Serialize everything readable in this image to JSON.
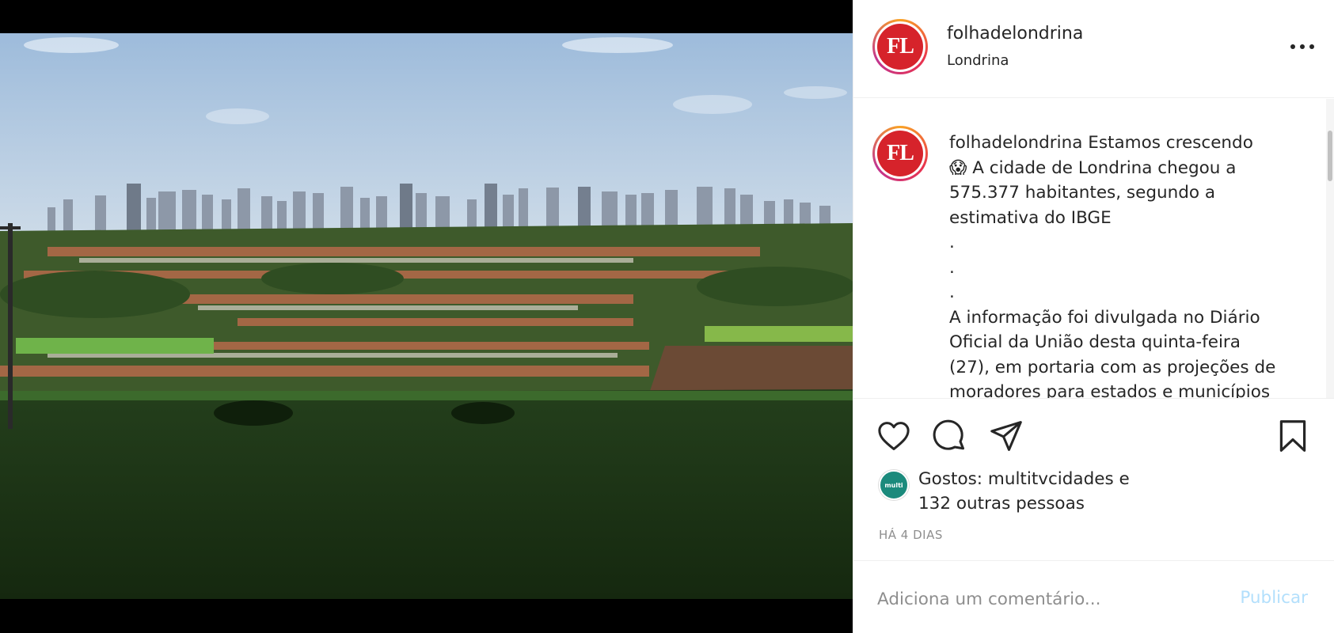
{
  "post": {
    "username": "folhadelondrina",
    "location": "Londrina",
    "avatar_initials": "FL",
    "caption": {
      "username": "folhadelondrina",
      "lines": [
        "Estamos crescendo",
        "😱 A cidade de Londrina chegou a",
        "575.377 habitantes, segundo a",
        "estimativa do IBGE",
        ".",
        ".",
        ".",
        "A informação foi divulgada no Diário",
        "Oficial da União desta quinta-feira",
        "(27), em portaria com as projeções de",
        "moradores para estados e municípios"
      ]
    },
    "likes": {
      "text_line1": "Gostos: multitvcidades e",
      "text_line2": "132 outras pessoas",
      "liker_avatar_label": "multi"
    },
    "timestamp": "HÁ 4 DIAS",
    "comment": {
      "placeholder": "Adiciona um comentário...",
      "publish_label": "Publicar"
    }
  },
  "icons": {
    "more": "more-options-icon",
    "like": "heart-icon",
    "comment": "comment-bubble-icon",
    "share": "paper-plane-icon",
    "save": "bookmark-icon"
  },
  "colors": {
    "brand_red": "#d6232b",
    "publish_disabled": "#b2dffc",
    "muted": "#8e8e8e"
  }
}
